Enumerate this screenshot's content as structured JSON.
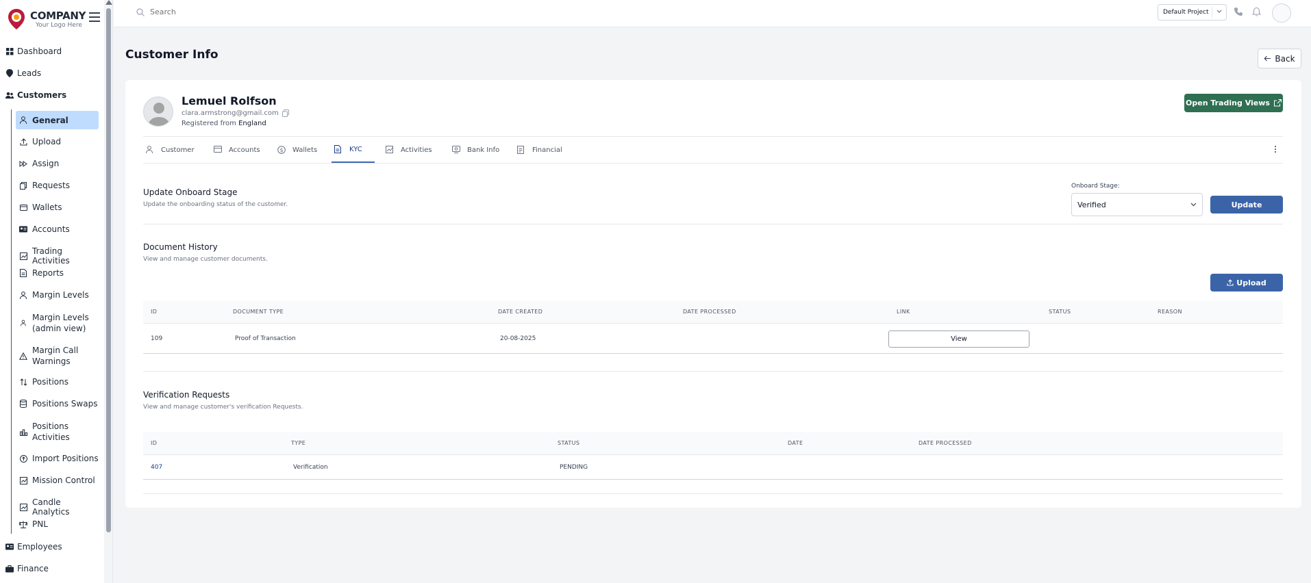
{
  "brand": {
    "name": "COMPANY",
    "tagline": "Your Logo Here"
  },
  "sidebar": {
    "top_items": [
      {
        "label": "Dashboard",
        "icon": "grid-icon"
      },
      {
        "label": "Leads",
        "icon": "pin-icon"
      },
      {
        "label": "Customers",
        "icon": "users-icon"
      }
    ],
    "sub_items": [
      {
        "label": "General",
        "icon": "user-icon"
      },
      {
        "label": "Upload",
        "icon": "upload-icon"
      },
      {
        "label": "Assign",
        "icon": "forward-icon"
      },
      {
        "label": "Requests",
        "icon": "files-icon"
      },
      {
        "label": "Wallets",
        "icon": "wallet-icon"
      },
      {
        "label": "Accounts",
        "icon": "id-card-icon"
      },
      {
        "label": "Trading Activities",
        "icon": "chart-icon"
      },
      {
        "label": "Reports",
        "icon": "document-icon"
      },
      {
        "label": "Margin Levels",
        "icon": "user-icon"
      },
      {
        "label": "Margin Levels (admin view)",
        "icon": "user-icon"
      },
      {
        "label": "Margin Call Warnings",
        "icon": "warning-icon"
      },
      {
        "label": "Positions",
        "icon": "sort-icon"
      },
      {
        "label": "Positions Swaps",
        "icon": "database-icon"
      },
      {
        "label": "Positions Activities",
        "icon": "bar-chart-icon"
      },
      {
        "label": "Import Positions",
        "icon": "import-icon"
      },
      {
        "label": "Mission Control",
        "icon": "chart-icon"
      },
      {
        "label": "Candle Analytics",
        "icon": "chart-icon"
      },
      {
        "label": "PNL",
        "icon": "scale-icon"
      }
    ],
    "bottom_items": [
      {
        "label": "Employees",
        "icon": "id-card-icon"
      },
      {
        "label": "Finance",
        "icon": "briefcase-icon"
      }
    ]
  },
  "topbar": {
    "search_placeholder": "Search",
    "project": "Default Project"
  },
  "page": {
    "title": "Customer Info",
    "back_label": "Back"
  },
  "customer": {
    "name": "Lemuel Rolfson",
    "email": "clara.armstrong@gmail.com",
    "registered_prefix": "Registered from",
    "country": "England",
    "trading_button": "Open Trading Views"
  },
  "tabs": [
    {
      "label": "Customer",
      "icon": "user-icon"
    },
    {
      "label": "Accounts",
      "icon": "card-icon"
    },
    {
      "label": "Wallets",
      "icon": "dollar-icon"
    },
    {
      "label": "KYC",
      "icon": "document-icon"
    },
    {
      "label": "Activities",
      "icon": "chart-icon"
    },
    {
      "label": "Bank Info",
      "icon": "bank-icon"
    },
    {
      "label": "Financial",
      "icon": "report-icon"
    }
  ],
  "onboard": {
    "title": "Update Onboard Stage",
    "desc": "Update the onboarding status of the customer.",
    "stage_label": "Onboard Stage:",
    "stage_value": "Verified",
    "update_label": "Update"
  },
  "documents": {
    "title": "Document History",
    "desc": "View and manage customer documents.",
    "upload_label": "Upload",
    "columns": [
      "ID",
      "DOCUMENT TYPE",
      "DATE CREATED",
      "DATE PROCESSED",
      "LINK",
      "STATUS",
      "REASON"
    ],
    "rows": [
      {
        "id": "109",
        "type": "Proof of Transaction",
        "created": "20-08-2025",
        "processed": "",
        "link": "View",
        "status": "",
        "reason": ""
      }
    ]
  },
  "verification": {
    "title": "Verification Requests",
    "desc": "View and manage customer's verification Requests.",
    "columns": [
      "ID",
      "TYPE",
      "STATUS",
      "DATE",
      "DATE PROCESSED"
    ],
    "rows": [
      {
        "id": "407",
        "type": "Verification",
        "status": "PENDING",
        "date": "",
        "processed": ""
      }
    ]
  },
  "colors": {
    "primary": "#3b64a8",
    "success": "#2f6f52",
    "active_nav": "#bfdbfe"
  }
}
